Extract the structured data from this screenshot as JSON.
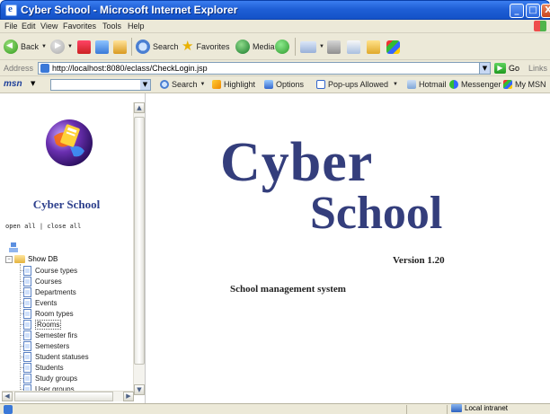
{
  "window": {
    "title": "Cyber School - Microsoft Internet Explorer",
    "min_glyph": "_",
    "max_glyph": "□",
    "close_glyph": "X"
  },
  "menu": [
    "File",
    "Edit",
    "View",
    "Favorites",
    "Tools",
    "Help"
  ],
  "toolbar": {
    "back_label": "Back",
    "search_label": "Search",
    "favorites_label": "Favorites",
    "media_label": "Media"
  },
  "address": {
    "label": "Address",
    "url": "http://localhost:8080/eclass/CheckLogin.jsp",
    "go_label": "Go",
    "links_label": "Links"
  },
  "msn": {
    "logo": "msn",
    "search_label": "Search",
    "highlight_label": "Highlight",
    "options_label": "Options",
    "popups_label": "Pop-ups Allowed",
    "hotmail_label": "Hotmail",
    "messenger_label": "Messenger",
    "mymsn_label": "My MSN"
  },
  "sidebar": {
    "school_name": "Cyber School",
    "open_all": "open all",
    "separator": " | ",
    "close_all": "close all",
    "root_label": "Show DB",
    "items": [
      "Course types",
      "Courses",
      "Departments",
      "Events",
      "Room types",
      "Rooms",
      "Semester firs",
      "Semesters",
      "Student statuses",
      "Students",
      "Study groups",
      "User groups"
    ]
  },
  "main": {
    "title_line1": "Cyber",
    "title_line2": "School",
    "version": "Version 1.20",
    "tagline": "School management system"
  },
  "status": {
    "zone": "Local intranet"
  }
}
